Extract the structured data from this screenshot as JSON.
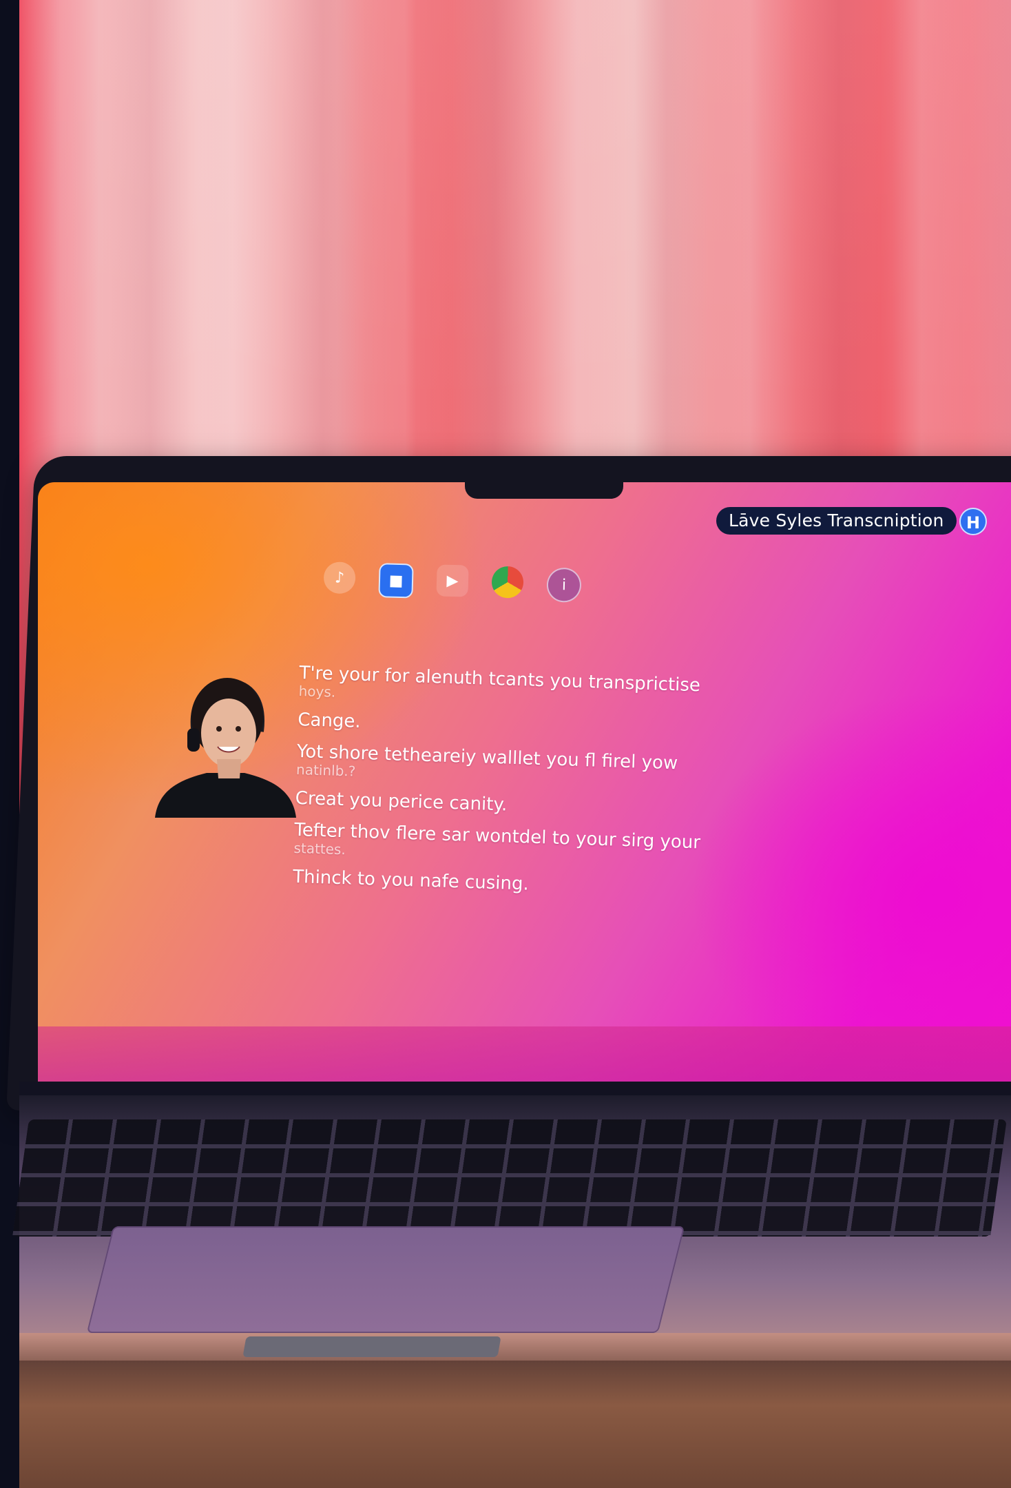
{
  "overlay": {
    "title": "Lāve Syles Transcniption",
    "badge_icon": "H"
  },
  "transcript": {
    "lines": [
      {
        "text": "T're your for alenuth tcants you transprictise",
        "sub": "hoys."
      },
      {
        "text": "Cange."
      },
      {
        "text": "Yot shore tetheareiy walllet you fl firel yow",
        "sub": "natinlb.?"
      },
      {
        "text": "Creat you perice canity."
      },
      {
        "text": "Tefter thov flere sar wontdel to your sirg your",
        "sub": "stattes."
      },
      {
        "text": "Thinck to you nafe cusing."
      }
    ]
  },
  "dock": {
    "icons": [
      "dock-speech-icon",
      "dock-app-icon",
      "dock-video-icon",
      "dock-browser-icon",
      "dock-info-icon"
    ]
  },
  "colors": {
    "screen_orange": "#f57a1c",
    "screen_magenta": "#ec18cf",
    "pill_background": "#101a3c",
    "badge_blue": "#2f6ff0"
  }
}
